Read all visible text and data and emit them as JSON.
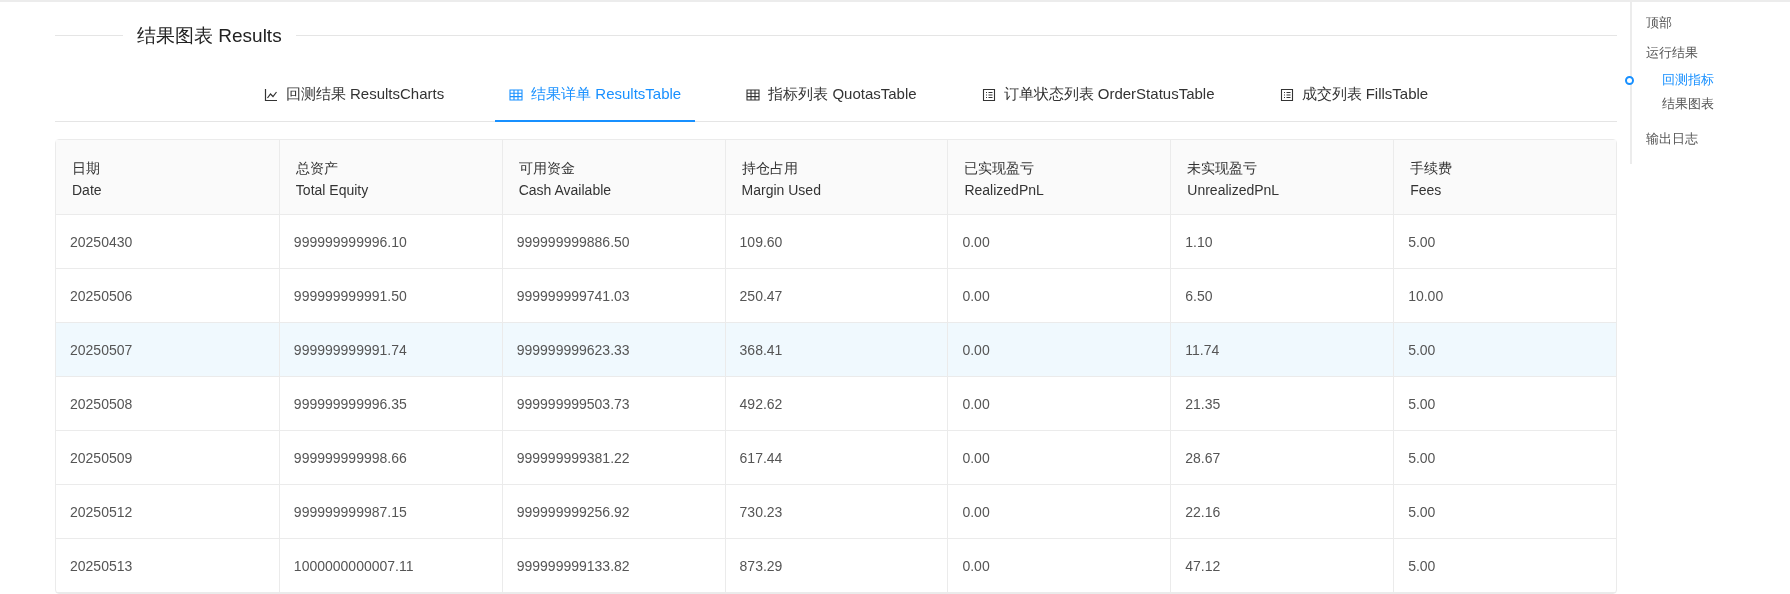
{
  "section": {
    "title": "结果图表 Results"
  },
  "tabs": [
    {
      "label": "回测结果 ResultsCharts",
      "kind": "chart",
      "selected": false
    },
    {
      "label": "结果详单 ResultsTable",
      "kind": "grid",
      "selected": true
    },
    {
      "label": "指标列表 QuotasTable",
      "kind": "grid",
      "selected": false
    },
    {
      "label": "订单状态列表 OrderStatusTable",
      "kind": "list",
      "selected": false
    },
    {
      "label": "成交列表 FillsTable",
      "kind": "list",
      "selected": false
    }
  ],
  "table": {
    "columns": [
      {
        "zh": "日期",
        "en": "Date"
      },
      {
        "zh": "总资产",
        "en": "Total Equity"
      },
      {
        "zh": "可用资金",
        "en": "Cash Available"
      },
      {
        "zh": "持仓占用",
        "en": "Margin Used"
      },
      {
        "zh": "已实现盈亏",
        "en": "RealizedPnL"
      },
      {
        "zh": "未实现盈亏",
        "en": "UnrealizedPnL"
      },
      {
        "zh": "手续费",
        "en": "Fees"
      }
    ],
    "rows": [
      {
        "selected": false,
        "cells": [
          "20250430",
          "999999999996.10",
          "999999999886.50",
          "109.60",
          "0.00",
          "1.10",
          "5.00"
        ]
      },
      {
        "selected": false,
        "cells": [
          "20250506",
          "999999999991.50",
          "999999999741.03",
          "250.47",
          "0.00",
          "6.50",
          "10.00"
        ]
      },
      {
        "selected": true,
        "cells": [
          "20250507",
          "999999999991.74",
          "999999999623.33",
          "368.41",
          "0.00",
          "11.74",
          "5.00"
        ]
      },
      {
        "selected": false,
        "cells": [
          "20250508",
          "999999999996.35",
          "999999999503.73",
          "492.62",
          "0.00",
          "21.35",
          "5.00"
        ]
      },
      {
        "selected": false,
        "cells": [
          "20250509",
          "999999999998.66",
          "999999999381.22",
          "617.44",
          "0.00",
          "28.67",
          "5.00"
        ]
      },
      {
        "selected": false,
        "cells": [
          "20250512",
          "999999999987.15",
          "999999999256.92",
          "730.23",
          "0.00",
          "22.16",
          "5.00"
        ]
      },
      {
        "selected": false,
        "cells": [
          "20250513",
          "1000000000007.11",
          "999999999133.82",
          "873.29",
          "0.00",
          "47.12",
          "5.00"
        ]
      }
    ]
  },
  "anchor": {
    "items": [
      {
        "label": "顶部",
        "selected": false
      },
      {
        "label": "运行结果",
        "selected": false,
        "children": [
          {
            "label": "回测指标",
            "selected": true
          },
          {
            "label": "结果图表",
            "selected": false
          }
        ]
      },
      {
        "label": "输出日志",
        "selected": false
      }
    ]
  }
}
